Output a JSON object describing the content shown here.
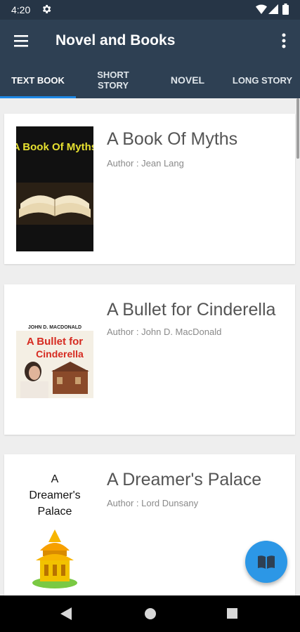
{
  "status_bar": {
    "time": "4:20"
  },
  "app_bar": {
    "title": "Novel and Books"
  },
  "tabs": [
    {
      "label": "TEXT BOOK",
      "selected": true
    },
    {
      "label": "SHORT STORY",
      "selected": false
    },
    {
      "label": "NOVEL",
      "selected": false
    },
    {
      "label": "LONG STORY",
      "selected": false
    }
  ],
  "books": [
    {
      "title": "A Book Of Myths",
      "author": "Author : Jean Lang",
      "cover": {
        "text": "A Book Of Myths"
      }
    },
    {
      "title": "A Bullet for Cinderella",
      "author": "Author : John D. MacDonald",
      "cover": {
        "author_text": "JOHN D. MACDONALD",
        "title_line1": "A Bullet for",
        "title_line2": "Cinderella"
      }
    },
    {
      "title": "A Dreamer's Palace",
      "author": "Author : Lord Dunsany",
      "cover": {
        "line1": "A",
        "line2": "Dreamer's",
        "line3": "Palace"
      }
    }
  ],
  "icons": {
    "menu": "menu-icon",
    "more": "more-vert-icon",
    "fab": "book-icon",
    "settings": "gear-icon",
    "wifi": "wifi-icon",
    "signal": "signal-icon",
    "battery": "battery-icon"
  },
  "colors": {
    "status_bar": "#263546",
    "app_bar": "#2e4053",
    "tab_indicator": "#1e88e5",
    "fab": "#2c97e6"
  }
}
